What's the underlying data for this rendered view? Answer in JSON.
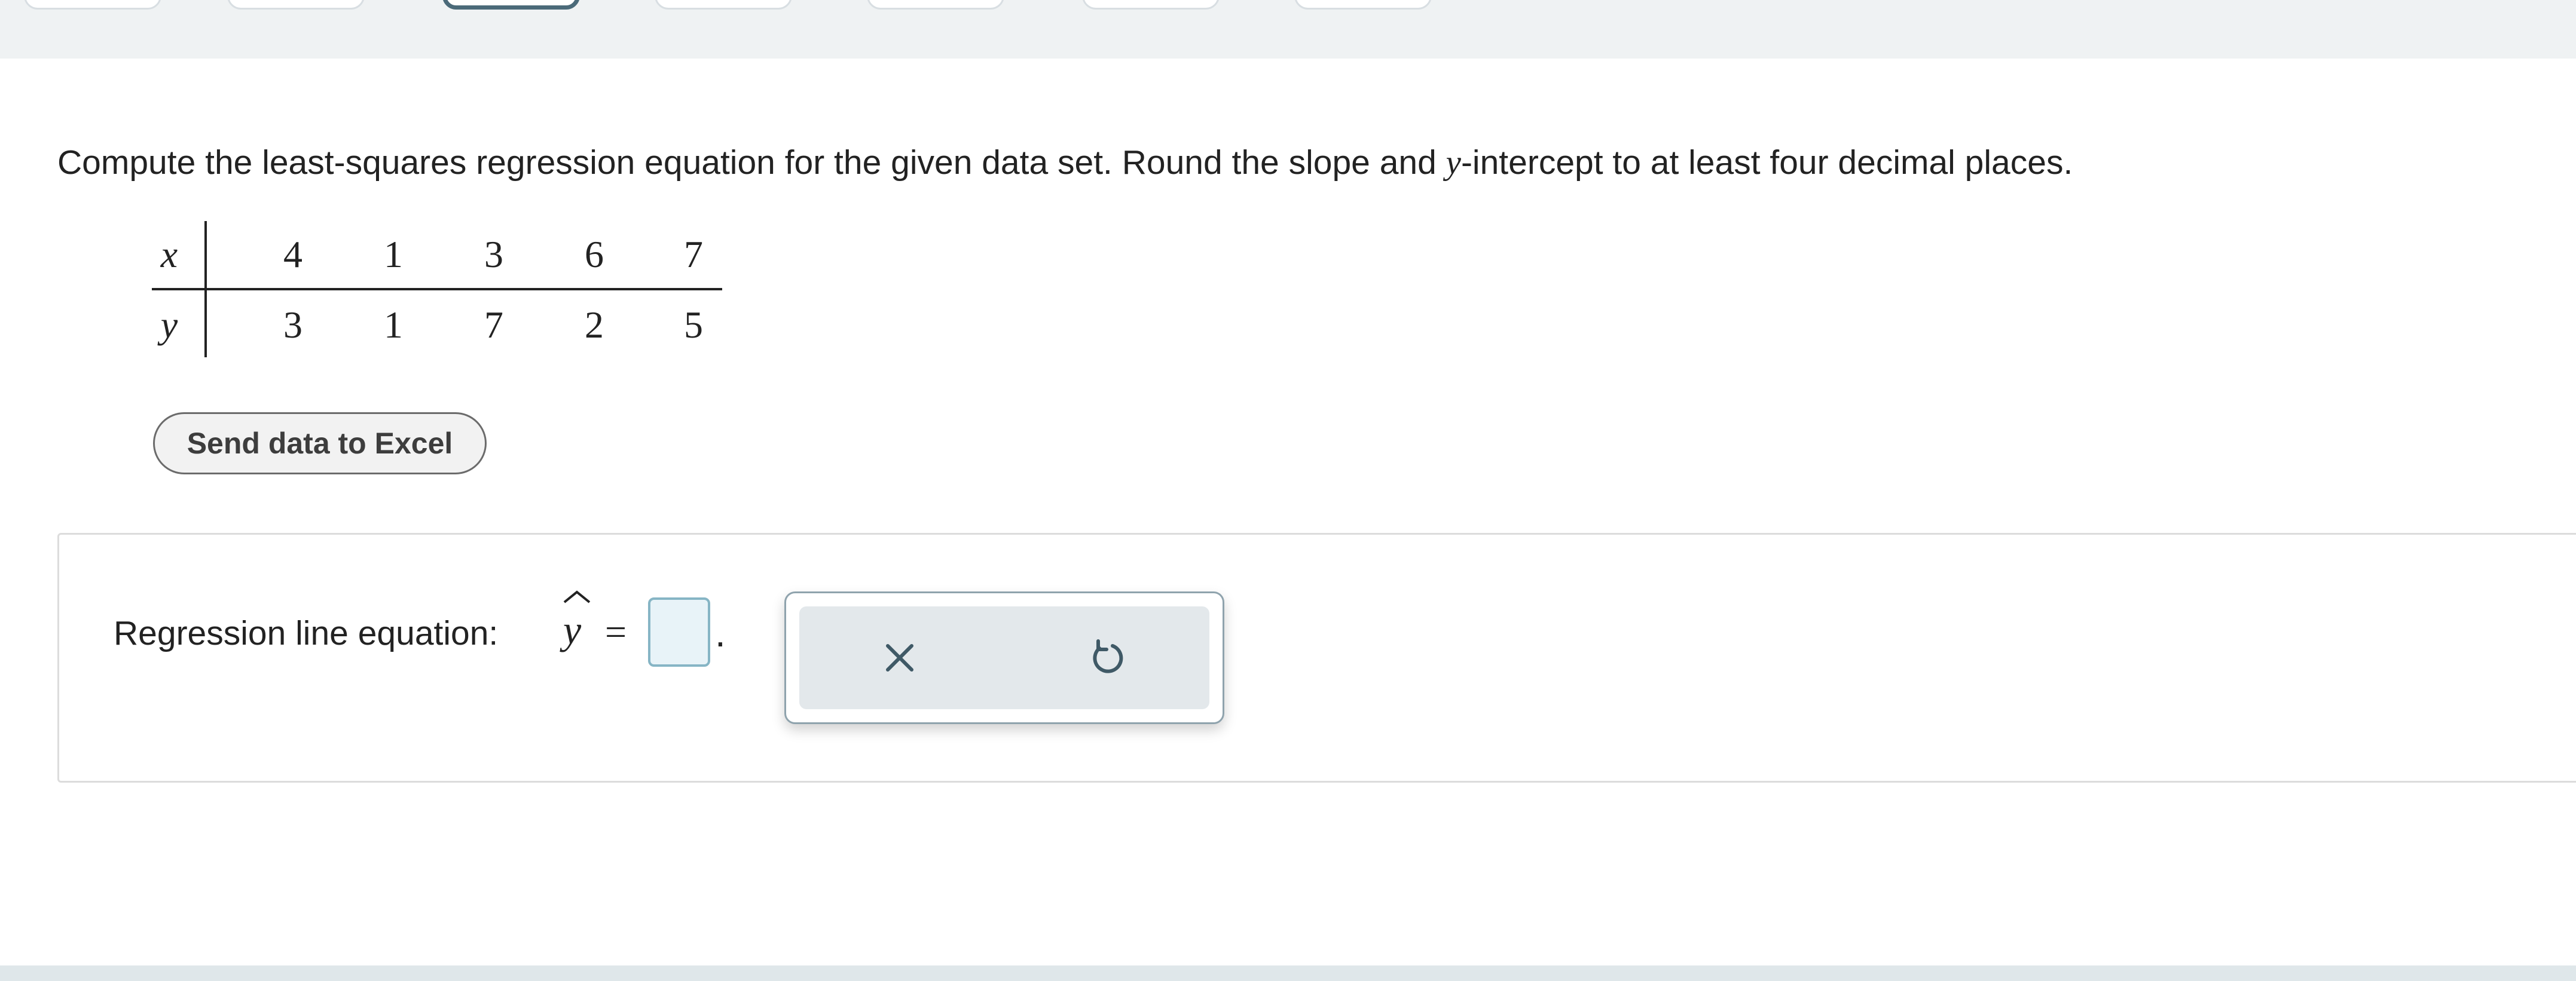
{
  "question": {
    "text_before": "Compute the least-squares regression equation for the given data set. Round the slope and ",
    "text_var": "y",
    "text_after": "-intercept to at least four decimal places."
  },
  "data_table": {
    "x_label": "x",
    "y_label": "y",
    "x_values": [
      "4",
      "1",
      "3",
      "6",
      "7"
    ],
    "y_values": [
      "3",
      "1",
      "7",
      "2",
      "5"
    ]
  },
  "excel_button": {
    "label": "Send data to Excel"
  },
  "answer": {
    "label": "Regression line equation:",
    "variable": "y",
    "equals": "=",
    "input_value": "",
    "period": "."
  },
  "tools": {
    "clear_icon": "x-icon",
    "undo_icon": "undo-icon"
  },
  "colors": {
    "accent": "#4b6a79",
    "input_border": "#86b5c5",
    "input_fill": "#e8f3f8",
    "panel_fill": "#e3e8eb"
  }
}
